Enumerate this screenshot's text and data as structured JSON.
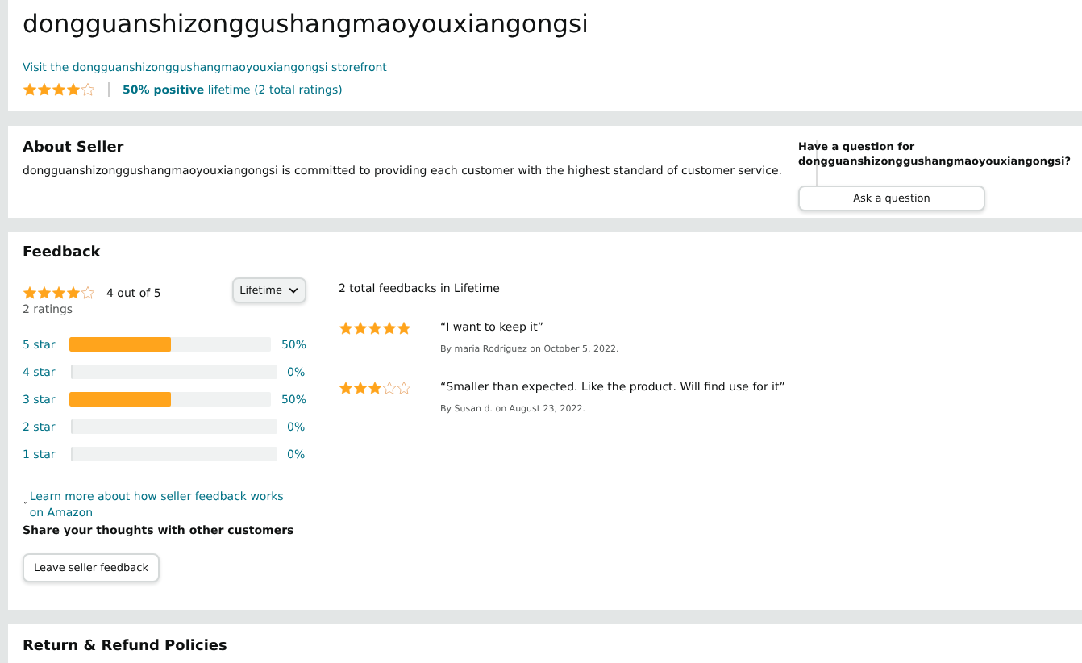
{
  "seller": {
    "name": "dongguanshizonggushangmaoyouxiangongsi",
    "storefront_link": "Visit the dongguanshizonggushangmaoyouxiangongsi storefront",
    "stars": 4,
    "rating_text": "**50% positive** lifetime (2 total ratings)"
  },
  "about": {
    "title": "About Seller",
    "description": "dongguanshizonggushangmaoyouxiangongsi is committed to providing each customer with the highest standard of customer service.",
    "question_title": "Have a question for dongguanshizonggushangmaoyouxiangongsi?",
    "ask_button": "Ask a question"
  },
  "feedback": {
    "title": "Feedback",
    "stars": 4,
    "out_of": "4 out of  5",
    "ratings_count": "2 ratings",
    "period_dropdown": "Lifetime",
    "histogram": [
      {
        "label": "5 star",
        "level": 0.5,
        "percent": "50%"
      },
      {
        "label": "4 star",
        "level": 0,
        "percent": "0%"
      },
      {
        "label": "3 star",
        "level": 0.5,
        "percent": "50%"
      },
      {
        "label": "2 star",
        "level": 0,
        "percent": "0%"
      },
      {
        "label": "1 star",
        "level": 0,
        "percent": "0%"
      }
    ],
    "total_text": "2 total feedbacks in Lifetime",
    "reviews": [
      {
        "stars": 5,
        "quote": "“I want to keep it”",
        "byline": "By maria Rodriguez on October 5, 2022."
      },
      {
        "stars": 3,
        "quote": "“Smaller than expected. Like the product. Will find use for it”",
        "byline": "By Susan d. on August 23, 2022."
      }
    ],
    "learn_more_link": "Learn more about how seller feedback works on Amazon",
    "share_title": "Share your thoughts with other customers",
    "leave_button": "Leave seller feedback"
  },
  "next_section": {
    "title": "Return & Refund Policies"
  }
}
